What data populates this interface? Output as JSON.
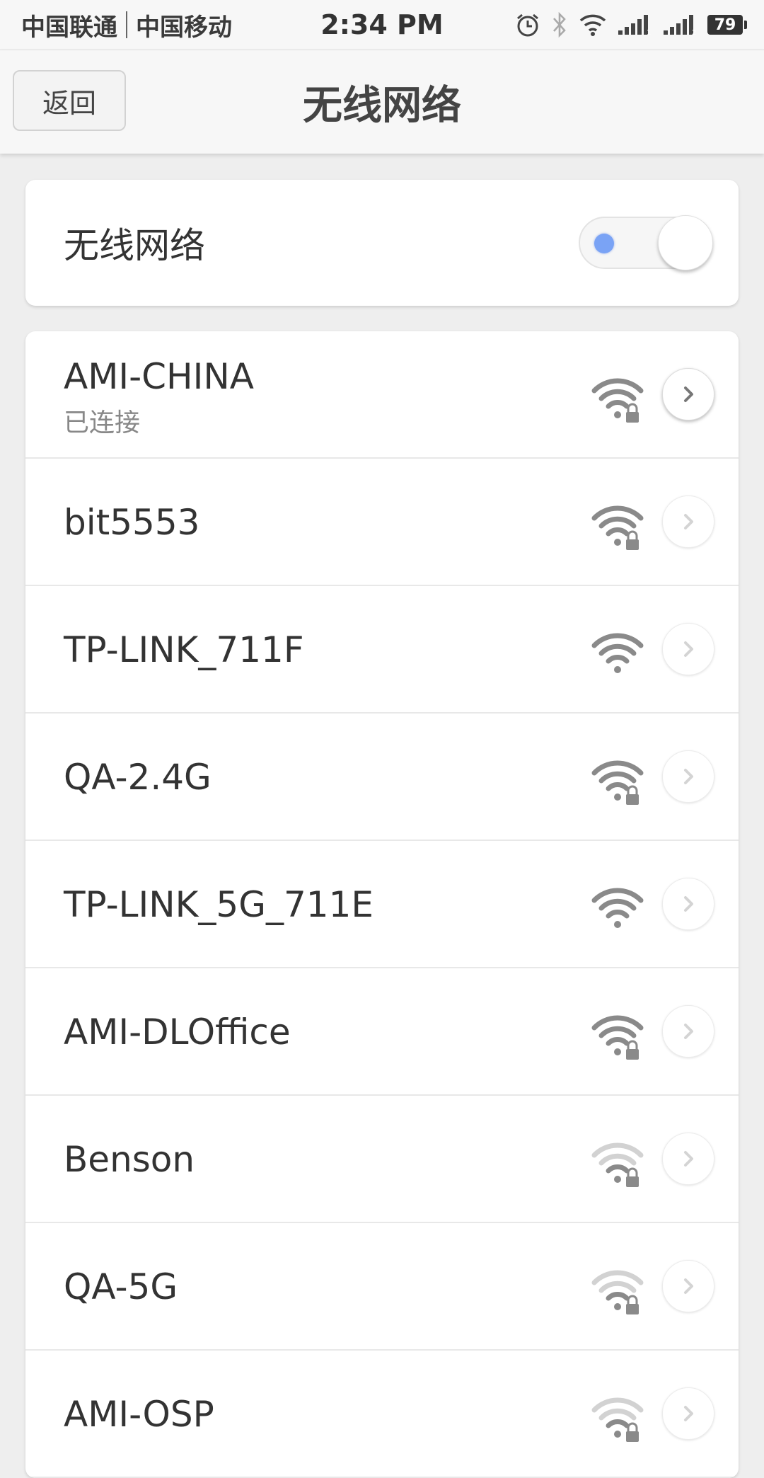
{
  "status_bar": {
    "carrier1": "中国联通",
    "carrier2": "中国移动",
    "time": "2:34 PM",
    "battery": "79",
    "icons": [
      "alarm-icon",
      "bluetooth-icon",
      "wifi-icon",
      "signal-sim1-icon",
      "signal-sim2-icon",
      "battery-icon"
    ]
  },
  "nav": {
    "back_label": "返回",
    "title": "无线网络"
  },
  "toggle": {
    "label": "无线网络",
    "state": "on",
    "accent": "#7aa3f5"
  },
  "networks": [
    {
      "ssid": "AMI-CHINA",
      "status": "已连接",
      "signal_level": 4,
      "secured": true,
      "active": true
    },
    {
      "ssid": "bit5553",
      "signal_level": 4,
      "secured": true
    },
    {
      "ssid": "TP-LINK_711F",
      "signal_level": 4,
      "secured": false
    },
    {
      "ssid": "QA-2.4G",
      "signal_level": 4,
      "secured": true
    },
    {
      "ssid": "TP-LINK_5G_711E",
      "signal_level": 4,
      "secured": false
    },
    {
      "ssid": "AMI-DLOffice",
      "signal_level": 4,
      "secured": true
    },
    {
      "ssid": "Benson",
      "signal_level": 2,
      "secured": true
    },
    {
      "ssid": "QA-5G",
      "signal_level": 2,
      "secured": true
    },
    {
      "ssid": "AMI-OSP",
      "signal_level": 2,
      "secured": true
    }
  ]
}
